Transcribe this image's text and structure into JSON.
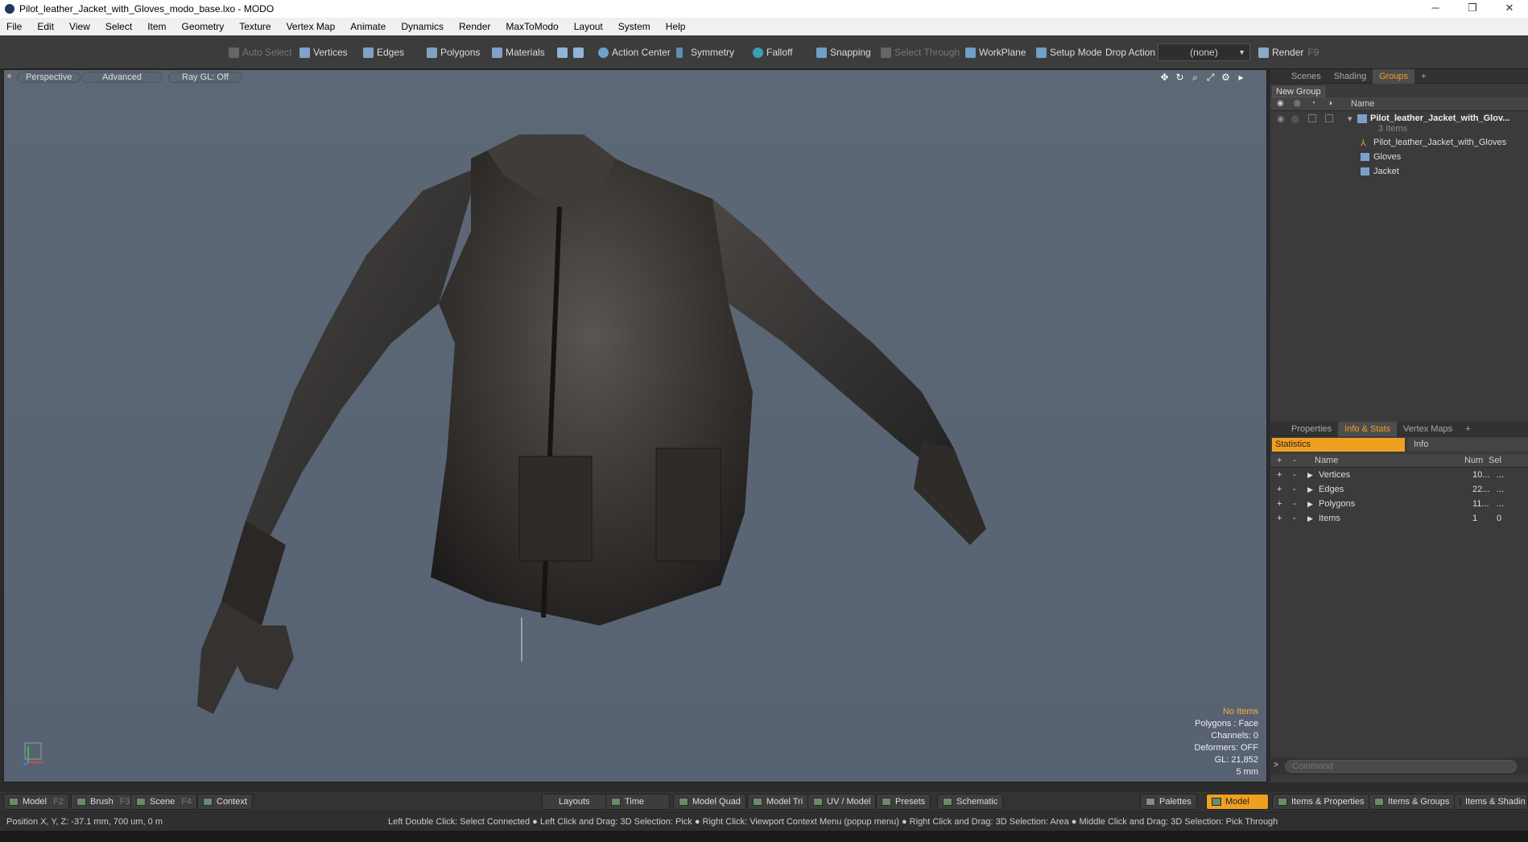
{
  "window": {
    "title": "Pilot_leather_Jacket_with_Gloves_modo_base.lxo - MODO",
    "minimize": "─",
    "maximize": "❐",
    "close": "✕"
  },
  "menu": [
    "File",
    "Edit",
    "View",
    "Select",
    "Item",
    "Geometry",
    "Texture",
    "Vertex Map",
    "Animate",
    "Dynamics",
    "Render",
    "MaxToModo",
    "Layout",
    "System",
    "Help"
  ],
  "toolbar": {
    "auto_select": "Auto Select",
    "vertices": "Vertices",
    "edges": "Edges",
    "polygons": "Polygons",
    "materials": "Materials",
    "action_center": "Action Center",
    "symmetry": "Symmetry",
    "falloff": "Falloff",
    "snapping": "Snapping",
    "select_through": "Select Through",
    "workplane": "WorkPlane",
    "setup_mode": "Setup Mode",
    "drop_action": "Drop Action",
    "drop_value": "(none)",
    "render": "Render",
    "render_key": "F9"
  },
  "viewport": {
    "view": "Perspective",
    "mode": "Advanced",
    "raygl": "Ray GL: Off",
    "stats": {
      "items": "No Items",
      "polygons": "Polygons : Face",
      "channels": "Channels: 0",
      "deformers": "Deformers: OFF",
      "gl": "GL: 21,852",
      "scale": "5 mm"
    }
  },
  "groups_panel": {
    "tabs": [
      "Scenes",
      "Shading",
      "Groups"
    ],
    "active_tab": "Groups",
    "new_group": "New Group",
    "name_header": "Name",
    "root": {
      "name": "Pilot_leather_Jacket_with_Glov...",
      "count": "3 Items"
    },
    "children": [
      "Pilot_leather_Jacket_with_Gloves",
      "Gloves",
      "Jacket"
    ]
  },
  "stats_panel": {
    "tabs": [
      "Properties",
      "Info & Stats",
      "Vertex Maps"
    ],
    "active_tab": "Info & Stats",
    "statistics": "Statistics",
    "info": "Info",
    "headers": {
      "name": "Name",
      "num": "Num",
      "sel": "Sel"
    },
    "rows": [
      {
        "name": "Vertices",
        "num": "10...",
        "sel": "..."
      },
      {
        "name": "Edges",
        "num": "22...",
        "sel": "..."
      },
      {
        "name": "Polygons",
        "num": "11...",
        "sel": "..."
      },
      {
        "name": "Items",
        "num": "1",
        "sel": "0"
      }
    ],
    "command_placeholder": "Command"
  },
  "bottom": {
    "model": "Model",
    "model_key": "F2",
    "brush": "Brush",
    "brush_key": "F3",
    "scene": "Scene",
    "scene_key": "F4",
    "context": "Context",
    "layouts": "Layouts",
    "time": "Time",
    "model_quad": "Model Quad",
    "model_tri": "Model Tri",
    "uv_model": "UV / Model",
    "presets": "Presets",
    "schematic": "Schematic",
    "palettes": "Palettes",
    "model_active": "Model",
    "items_props": "Items & Properties",
    "items_groups": "Items & Groups",
    "items_shading": "Items & Shadin"
  },
  "status": {
    "position": "Position X, Y, Z:   -37.1 mm, 700 um, 0 m",
    "hint": "Left Double Click: Select Connected ● Left Click and Drag: 3D Selection: Pick ● Right Click: Viewport Context Menu (popup menu) ● Right Click and Drag: 3D Selection: Area ● Middle Click and Drag: 3D Selection: Pick Through"
  }
}
